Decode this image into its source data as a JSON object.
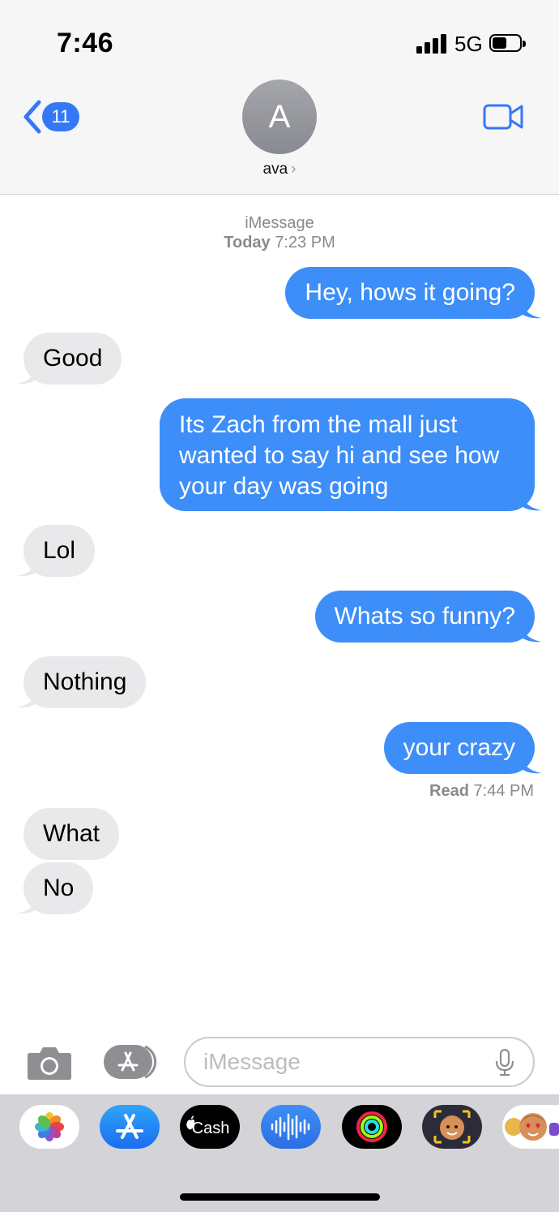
{
  "status_bar": {
    "time": "7:46",
    "network": "5G"
  },
  "header": {
    "back_count": "11",
    "avatar_initial": "A",
    "contact_name": "ava",
    "contact_chevron": "›"
  },
  "conversation": {
    "service": "iMessage",
    "timestamp_day": "Today",
    "timestamp_time": "7:23 PM",
    "messages": [
      {
        "direction": "outgoing",
        "text": "Hey, hows it going?"
      },
      {
        "direction": "incoming",
        "text": "Good"
      },
      {
        "direction": "outgoing",
        "text_lines": [
          "Its Zach from the mall just",
          "wanted to say hi and see how",
          "your day was going"
        ]
      },
      {
        "direction": "incoming",
        "text": "Lol"
      },
      {
        "direction": "outgoing",
        "text": "Whats so funny?"
      },
      {
        "direction": "incoming",
        "text": "Nothing"
      },
      {
        "direction": "outgoing",
        "text": "your crazy"
      },
      {
        "direction": "incoming",
        "text": "What"
      },
      {
        "direction": "incoming",
        "text": "No"
      }
    ],
    "read_label": "Read",
    "read_time": "7:44 PM"
  },
  "input_bar": {
    "placeholder": "iMessage"
  },
  "app_drawer": {
    "apps": [
      "photos-icon",
      "app-store-icon",
      "apple-cash-icon",
      "audio-message-icon",
      "activity-icon",
      "memoji-icon",
      "animoji-icon"
    ],
    "cash_label": "Cash"
  },
  "colors": {
    "outgoing_bubble": "#3d8ef8",
    "incoming_bubble": "#e9e9eb",
    "accent": "#3478f6"
  }
}
